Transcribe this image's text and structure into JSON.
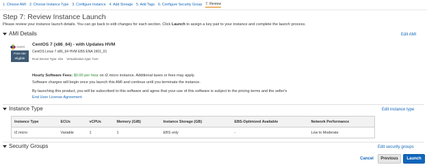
{
  "wizard": {
    "steps": [
      "1. Choose AMI",
      "2. Choose Instance Type",
      "3. Configure Instance",
      "4. Add Storage",
      "5. Add Tags",
      "6. Configure Security Group",
      "7. Review"
    ],
    "active_index": 6
  },
  "page": {
    "title": "Step 7: Review Instance Launch",
    "intro_before": "Please review your instance launch details. You can go back to edit changes for each section. Click ",
    "intro_bold": "Launch",
    "intro_after": " to assign a key pair to your instance and complete the launch process."
  },
  "ami_section": {
    "heading": "AMI Details",
    "edit_label": "Edit AMI",
    "logo_text": "CentOS",
    "badge_line1": "Free tier",
    "badge_line2": "eligible",
    "name": "CentOS 7 (x86_64) - with Updates HVM",
    "description": "CentOS Linux 7 x86_64 HVM EBS ENA 1901_01",
    "root_device": "Root Device Type: ebs",
    "virtualization": "Virtualization type: hvm",
    "fees_label": "Hourly Software Fees:",
    "fees_value": "$0.00 per hour",
    "fees_rest": " on t2.micro instance. Additional taxes or fees may apply.",
    "fees_line2": "Software charges will begin once you launch this AMI and continue until you terminate the instance.",
    "subscribe_text": "By launching this product, you will be subscribed to this software and agree that your use of this software is subject to the pricing terms and the seller's",
    "eula_link": "End User License Agreement"
  },
  "instance_section": {
    "heading": "Instance Type",
    "edit_label": "Edit instance type",
    "columns": [
      "Instance Type",
      "ECUs",
      "vCPUs",
      "Memory (GiB)",
      "Instance Storage (GB)",
      "EBS-Optimized Available",
      "Network Performance"
    ],
    "row": [
      "t2.micro",
      "Variable",
      "1",
      "1",
      "EBS only",
      "-",
      "Low to Moderate"
    ]
  },
  "security_section": {
    "heading": "Security Groups",
    "edit_label": "Edit security groups"
  },
  "footer": {
    "cancel_label": "Cancel",
    "previous_label": "Previous",
    "launch_label": "Launch"
  }
}
